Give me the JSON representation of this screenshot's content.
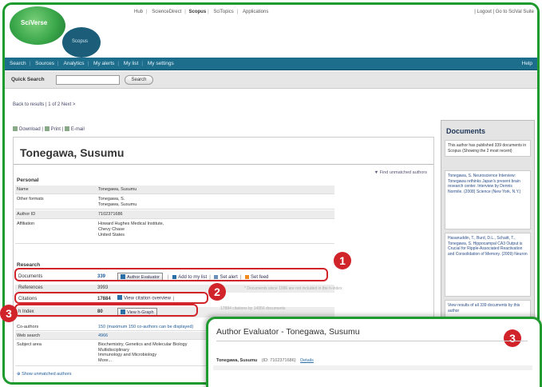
{
  "header": {
    "logo_main": "SciVerse",
    "logo_sub": "Scopus",
    "top_links": [
      "Hub",
      "ScienceDirect",
      "Scopus",
      "SciTopics",
      "Applications"
    ],
    "top_active": "Scopus",
    "user_links": "| Logout | Go to SciVal Suite"
  },
  "nav": {
    "items": [
      "Search",
      "Sources",
      "Analytics",
      "My alerts",
      "My list",
      "My settings"
    ],
    "help": "Help"
  },
  "quick_search": {
    "label": "Quick Search",
    "input_value": "",
    "button": "Search"
  },
  "breadcrumb": "Back to results | 1 of 2 Next >",
  "actions": [
    "Download",
    "Print",
    "E-mail"
  ],
  "author": {
    "name": "Tonegawa, Susumu",
    "find_link": "Find unmatched authors",
    "personal_title": "Personal",
    "personal": [
      {
        "label": "Name",
        "value": "Tonegawa, Susumu"
      },
      {
        "label": "Other formats",
        "value": "Tonegawa, S.\nTonegawa, Susumu"
      },
      {
        "label": "Author ID",
        "value": "7102371686"
      },
      {
        "label": "Affiliation",
        "value": "Howard Hughes Medical Institute,\nChevy Chase\nUnited States"
      }
    ],
    "research_title": "Research",
    "research": {
      "documents_label": "Documents",
      "documents_value": "339",
      "references_label": "References",
      "references_value": "3993",
      "citations_label": "Citations",
      "citations_value": "17884",
      "hindex_label": "h Index",
      "hindex_value": "80"
    },
    "extra": [
      {
        "label": "Co-authors",
        "value": "150 (maximum 150 co-authors can be displayed)"
      },
      {
        "label": "Web search",
        "value": "4966"
      },
      {
        "label": "Subject area",
        "value": "Biochemistry, Genetics and Molecular Biology\nMultidisciplinary\nImmunology and Microbiology\nMore..."
      }
    ],
    "show_link": "Show unmatched authors"
  },
  "buttons": {
    "author_evaluator": "Author Evaluator",
    "add_to_list": "Add to my list",
    "set_alert": "Set alert",
    "set_feed": "Set feed",
    "view_citation": "View citation overview",
    "view_hgraph": "View h-Graph"
  },
  "notes": {
    "citations_note": "17884 citations by 14956 documents",
    "unmatched_note": "* Documents since 1996 are not included in the h-index"
  },
  "sidebar": {
    "title": "Documents",
    "intro": "This author has published 339 documents in Scopus (Showing the 2 most recent)",
    "doc1": "Tonegawa, S. Neuroscience Interview: Tonegawa rethinks Japan's present brain research center. Interview by Dennis Normile. (2008) Science (New York, N.Y.)",
    "doc2": "Hasanuddin, T., Burd, D.L., Schaitt, T., Tonegawa, S. Hippocampal CA3 Output is Crucial for Ripple-Associated Reactivation and Consolidation of Memory. (2009) Neuron",
    "view_all": "View results of all 339 documents by this author"
  },
  "popup": {
    "title": "Author Evaluator - Tonegawa, Susumu",
    "author": "Tonegawa, Susumu",
    "author_id": "(ID: 7102371686)",
    "details_link": "Details"
  },
  "callouts": [
    "1",
    "2",
    "3",
    "3"
  ],
  "colors": {
    "frame_green": "#1e9a2e",
    "nav_blue": "#1d6d8c",
    "highlight_red": "#d1232a"
  }
}
